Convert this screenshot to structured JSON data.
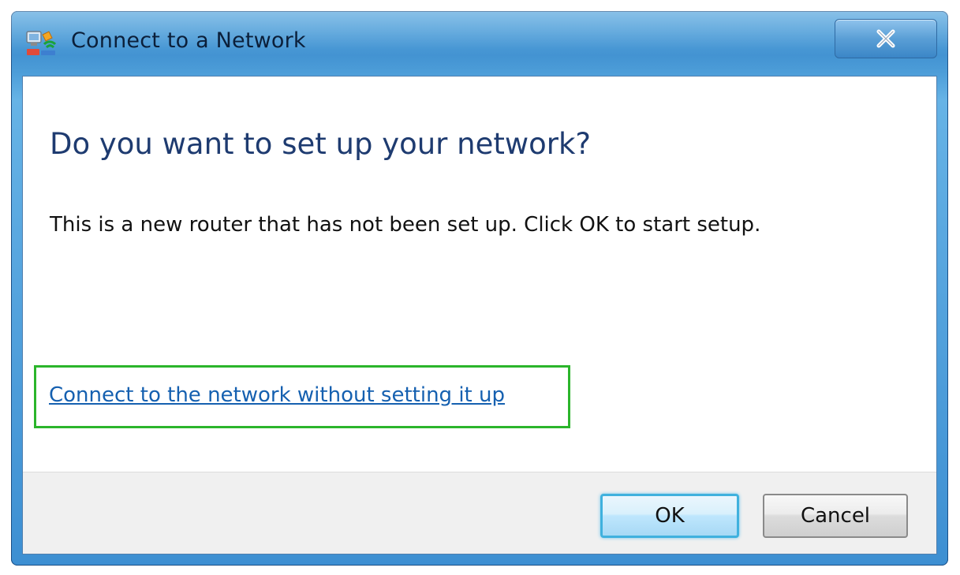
{
  "window": {
    "title": "Connect to a Network",
    "icon": "network-icon",
    "close_icon": "close-icon"
  },
  "dialog": {
    "heading": "Do you want to set up your network?",
    "message": "This is a new router that has not been set up. Click OK to start setup.",
    "link": "Connect to the network without setting it up",
    "highlight_color": "#2bb52b"
  },
  "buttons": {
    "ok": "OK",
    "cancel": "Cancel"
  }
}
